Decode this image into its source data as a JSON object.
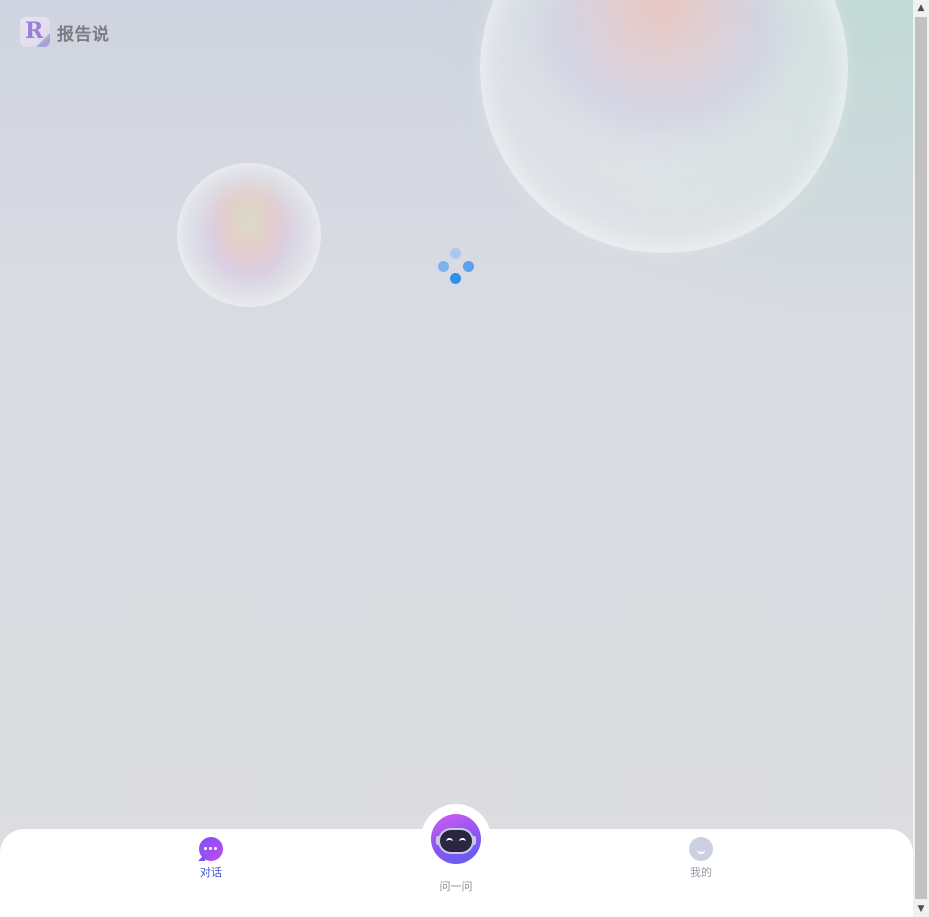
{
  "app": {
    "logo_text": "报告说",
    "logo_letter": "R"
  },
  "loading": {
    "icon": "loading-dots-icon"
  },
  "tabbar": {
    "chat": {
      "label": "对话",
      "icon": "chat-bubble-icon",
      "active": true,
      "color": "#3e4fd6"
    },
    "ask": {
      "label": "问一问",
      "icon": "robot-icon"
    },
    "mine": {
      "label": "我的",
      "icon": "smile-face-icon",
      "color": "#9a9ba5"
    }
  },
  "colors": {
    "accent": "#3e4fd6",
    "spinner": "#2f8fe9",
    "gradient_start": "#d35bf2",
    "gradient_end": "#5a60f0"
  },
  "scrollbar": {
    "up_icon": "scroll-up-arrow-icon",
    "down_icon": "scroll-down-arrow-icon"
  }
}
